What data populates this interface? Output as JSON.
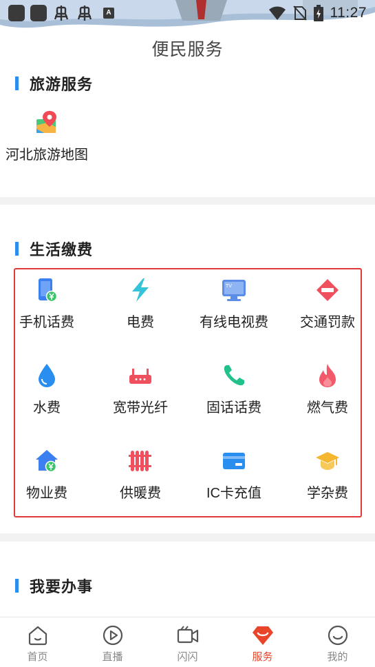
{
  "status_bar": {
    "time": "11:27",
    "indicator": "A"
  },
  "header": {
    "title": "便民服务"
  },
  "tourism": {
    "title": "旅游服务",
    "items": [
      {
        "label": "河北旅游地图",
        "icon": "map-pin-icon"
      }
    ]
  },
  "bills": {
    "title": "生活缴费",
    "items": [
      {
        "label": "手机话费",
        "icon": "mobile-phone-icon"
      },
      {
        "label": "电费",
        "icon": "lightning-icon"
      },
      {
        "label": "有线电视费",
        "icon": "tv-icon"
      },
      {
        "label": "交通罚款",
        "icon": "traffic-sign-icon"
      },
      {
        "label": "水费",
        "icon": "water-drop-icon"
      },
      {
        "label": "宽带光纤",
        "icon": "router-icon"
      },
      {
        "label": "固话话费",
        "icon": "telephone-icon"
      },
      {
        "label": "燃气费",
        "icon": "flame-icon"
      },
      {
        "label": "物业费",
        "icon": "house-icon"
      },
      {
        "label": "供暖费",
        "icon": "radiator-icon"
      },
      {
        "label": "IC卡充值",
        "icon": "card-icon"
      },
      {
        "label": "学杂费",
        "icon": "graduation-cap-icon"
      }
    ]
  },
  "services": {
    "title": "我要办事"
  },
  "tabs": [
    {
      "label": "首页",
      "icon": "home-icon",
      "active": false
    },
    {
      "label": "直播",
      "icon": "play-icon",
      "active": false
    },
    {
      "label": "闪闪",
      "icon": "video-camera-icon",
      "active": false
    },
    {
      "label": "服务",
      "icon": "service-diamond-icon",
      "active": true
    },
    {
      "label": "我的",
      "icon": "smile-face-icon",
      "active": false
    }
  ],
  "colors": {
    "accent": "#2a8ef0",
    "active_tab": "#e8452a",
    "highlight_border": "#e23a3a"
  }
}
